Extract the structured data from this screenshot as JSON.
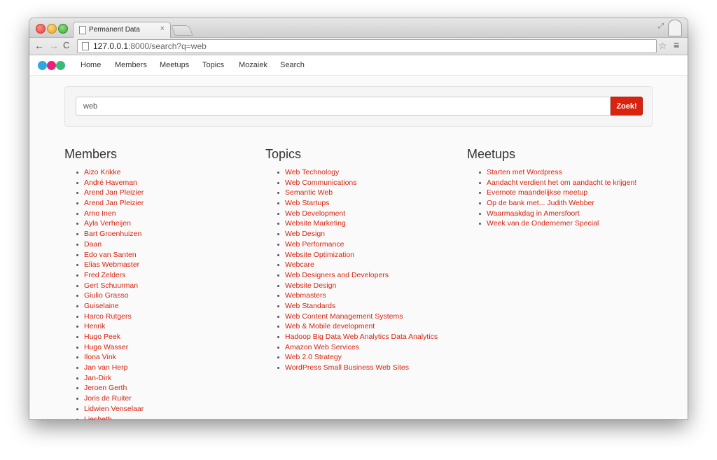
{
  "browser": {
    "tab_title": "Permanent Data",
    "tab_close": "×",
    "url_host": "127.0.0.1",
    "url_rest": ":8000/search?q=web"
  },
  "icons": {
    "back": "←",
    "forward": "→",
    "reload": "C",
    "star": "☆",
    "menu": "≡",
    "resize": "⤢",
    "close": "×"
  },
  "nav": {
    "items": [
      "Home",
      "Members",
      "Meetups",
      "Topics",
      "Mozaiek",
      "Search"
    ]
  },
  "search": {
    "value": "web",
    "button_label": "Zoek!"
  },
  "colors": {
    "accent": "#d9230f",
    "logo": [
      "#2ea7e0",
      "#e8227a",
      "#3cb878"
    ]
  },
  "members": {
    "heading": "Members",
    "items": [
      "Aizo Krikke",
      "André Haveman",
      "Arend Jan Pleizier",
      "Arend Jan Pleizier",
      "Arno Inen",
      "Ayla Verheijen",
      "Bart Groenhuizen",
      "Daan",
      "Edo van Santen",
      "Elias Webmaster",
      "Fred Zelders",
      "Gert Schuurman",
      "Giulio Grasso",
      "Guiselaine",
      "Harco Rutgers",
      "Henrik",
      "Hugo Peek",
      "Hugo Wasser",
      "Ilona Vink",
      "Jan van Herp",
      "Jan-Dirk",
      "Jeroen Gerth",
      "Joris de Ruiter",
      "Lidwien Venselaar",
      "Liesbeth"
    ]
  },
  "topics": {
    "heading": "Topics",
    "items": [
      "Web Technology",
      "Web Communications",
      "Semantic Web",
      "Web Startups",
      "Web Development",
      "Website Marketing",
      "Web Design",
      "Web Performance",
      "Website Optimization",
      "Webcare",
      "Web Designers and Developers",
      "Website Design",
      "Webmasters",
      "Web Standards",
      "Web Content Management Systems",
      "Web & Mobile development",
      "Hadoop Big Data Web Analytics Data Analytics",
      "Amazon Web Services",
      "Web 2.0 Strategy",
      "WordPress Small Business Web Sites"
    ]
  },
  "meetups": {
    "heading": "Meetups",
    "items": [
      "Starten met Wordpress",
      "Aandacht verdient het om aandacht te krijgen!",
      "Evernote maandelijkse meetup",
      "Op de bank met... Judith Webber",
      "Waarmaakdag in Amersfoort",
      "Week van de Ondernemer Special"
    ]
  }
}
